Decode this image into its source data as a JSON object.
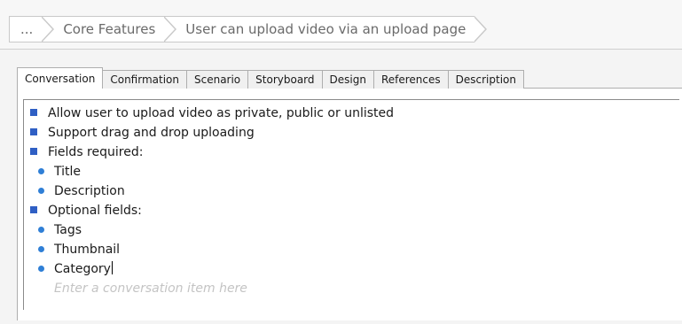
{
  "breadcrumb": {
    "items": [
      "...",
      "Core Features",
      "User can upload video via an upload page"
    ]
  },
  "tabs": [
    {
      "label": "Conversation",
      "active": true
    },
    {
      "label": "Confirmation",
      "active": false
    },
    {
      "label": "Scenario",
      "active": false
    },
    {
      "label": "Storyboard",
      "active": false
    },
    {
      "label": "Design",
      "active": false
    },
    {
      "label": "References",
      "active": false
    },
    {
      "label": "Description",
      "active": false
    }
  ],
  "conversation": {
    "items": [
      {
        "level": 1,
        "text": "Allow user to upload video as private, public or unlisted"
      },
      {
        "level": 1,
        "text": "Support drag and drop uploading"
      },
      {
        "level": 1,
        "text": "Fields required:"
      },
      {
        "level": 2,
        "text": "Title"
      },
      {
        "level": 2,
        "text": "Description"
      },
      {
        "level": 1,
        "text": "Optional fields:"
      },
      {
        "level": 2,
        "text": "Tags"
      },
      {
        "level": 2,
        "text": "Thumbnail"
      },
      {
        "level": 2,
        "text": "Category"
      }
    ],
    "placeholder": "Enter a conversation item here"
  },
  "colors": {
    "bullet_square": "#2f5fc4",
    "bullet_dot": "#2f7fd6",
    "placeholder": "#c4c4c4"
  }
}
